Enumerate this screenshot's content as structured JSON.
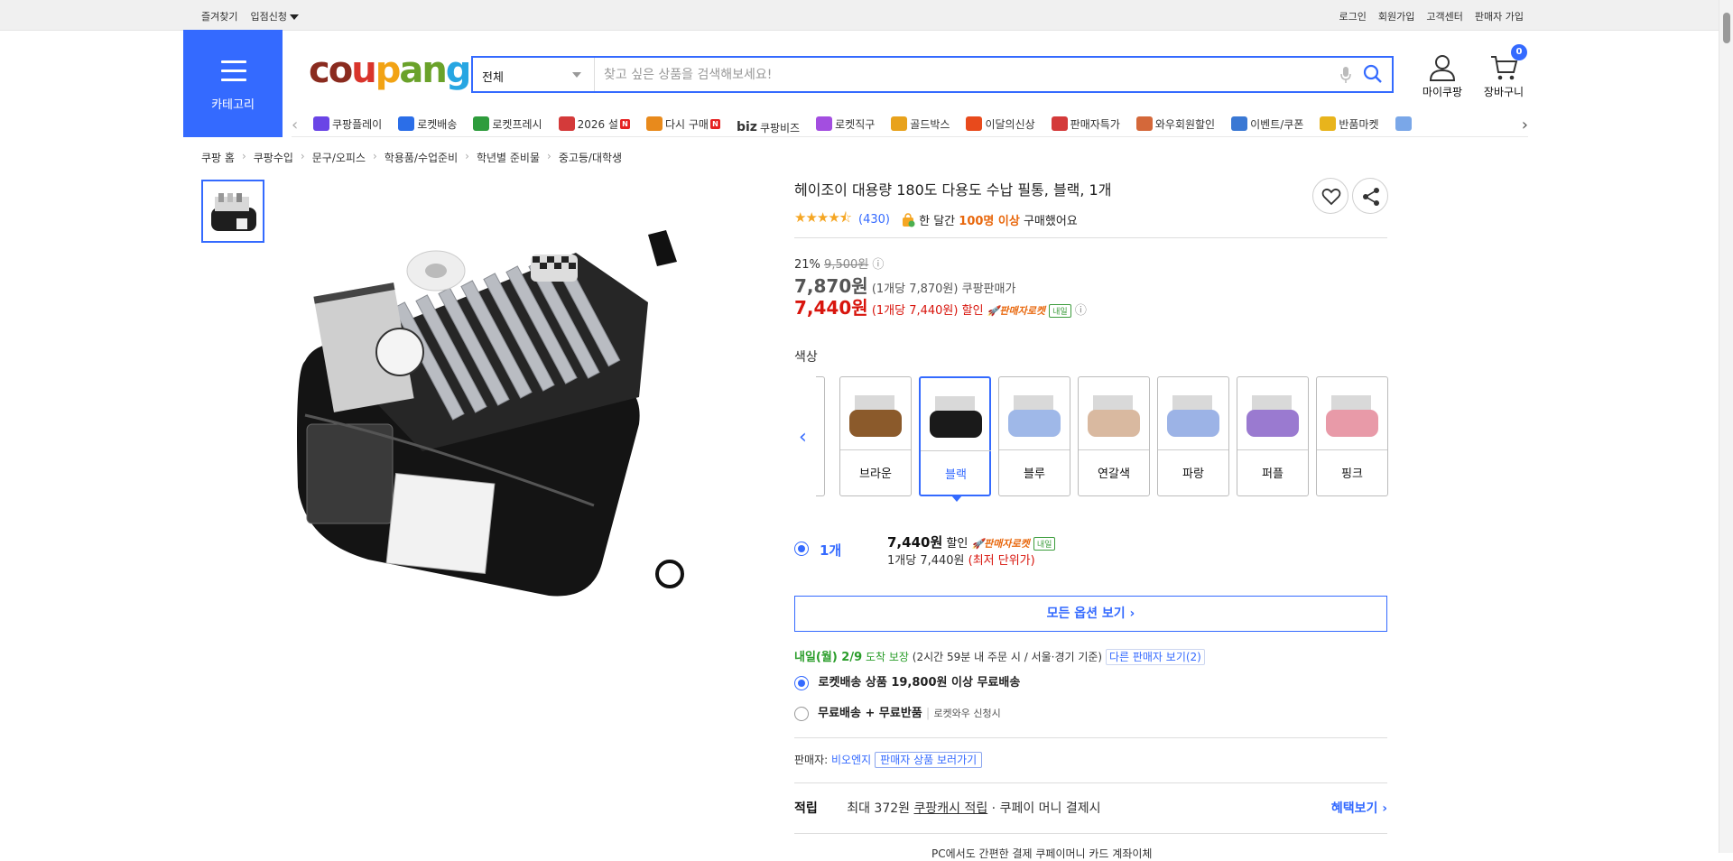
{
  "topbar": {
    "favorites": "즐겨찾기",
    "seller_apply": "입점신청",
    "login": "로그인",
    "signup": "회원가입",
    "customer_center": "고객센터",
    "seller_signup": "판매자 가입"
  },
  "header": {
    "category_label": "카테고리",
    "search_scope": "전체",
    "search_placeholder": "찾고 싶은 상품을 검색해보세요!",
    "my_coupang": "마이쿠팡",
    "cart_label": "장바구니",
    "cart_count": "0"
  },
  "quick_nav": [
    {
      "label": "쿠팡플레이",
      "color": "#6a45e6"
    },
    {
      "label": "로켓배송",
      "color": "#2b6ee8"
    },
    {
      "label": "로켓프레시",
      "color": "#2e9c3c"
    },
    {
      "label": "2026 설",
      "color": "#d43a3a",
      "badge": "N"
    },
    {
      "label": "다시 구매",
      "color": "#e88a1c",
      "badge": "N"
    },
    {
      "label": "쿠팡비즈",
      "prefix": "biz",
      "color": "#333333"
    },
    {
      "label": "로켓직구",
      "color": "#a34ee0"
    },
    {
      "label": "골드박스",
      "color": "#e8a21c"
    },
    {
      "label": "이달의신상",
      "color": "#e84a1c"
    },
    {
      "label": "판매자특가",
      "color": "#d43a3a"
    },
    {
      "label": "와우회원할인",
      "color": "#d4683a"
    },
    {
      "label": "이벤트/쿠폰",
      "color": "#3a78d4"
    },
    {
      "label": "반품마켓",
      "color": "#e8b41c"
    },
    {
      "label": "",
      "color": "#7aa7e8"
    }
  ],
  "breadcrumb": [
    "쿠팡 홈",
    "쿠팡수입",
    "문구/오피스",
    "학용품/수업준비",
    "학년별 준비물",
    "중고등/대학생"
  ],
  "product": {
    "title": "헤이조이 대용량 180도 다용도 수납 필통, 블랙, 1개",
    "rating": 4.5,
    "review_count": "(430)",
    "purchase_prefix": "한 달간 ",
    "purchase_highlight": "100명 이상",
    "purchase_suffix": " 구매했어요",
    "discount_rate": "21%",
    "original_price": "9,500원",
    "sale_price": "7,870원",
    "sale_unit": "(1개당 7,870원)",
    "sale_source": "쿠팡판매가",
    "final_price": "7,440원",
    "final_unit": "(1개당 7,440원)",
    "final_label": "할인",
    "rocket_label": "판매자로켓",
    "tomorrow_badge": "내일"
  },
  "color_option": {
    "label": "색상",
    "swatches": [
      {
        "name": "브라운",
        "color": "#8b5a2b",
        "selected": false
      },
      {
        "name": "블랙",
        "color": "#1a1a1a",
        "selected": true
      },
      {
        "name": "블루",
        "color": "#9fb8e8",
        "selected": false
      },
      {
        "name": "연갈색",
        "color": "#d9b9a0",
        "selected": false
      },
      {
        "name": "파랑",
        "color": "#9cb3e6",
        "selected": false
      },
      {
        "name": "퍼플",
        "color": "#9a7ad0",
        "selected": false
      },
      {
        "name": "핑크",
        "color": "#e89aa8",
        "selected": false
      }
    ]
  },
  "quantity_option": {
    "qty": "1개",
    "price": "7,440원",
    "discount_label": "할인",
    "rocket_label": "판매자로켓",
    "tomorrow_badge": "내일",
    "unit_price": "1개당 7,440원",
    "lowest": "(최저 단위가)"
  },
  "all_options": "모든 옵션 보기 ›",
  "delivery": {
    "date": "내일(월) 2/9",
    "arrive": " 도착 보장",
    "cond": "(2시간 59분 내 주문 시 / 서울·경기 기준)",
    "other_sellers": "다른 판매자 보기(2)",
    "ship1": "로켓배송 상품 19,800원 이상 무료배송",
    "ship2_bold": "무료배송 + 무료반품",
    "ship2_sub": "로켓와우 신청시"
  },
  "seller": {
    "label": "판매자: ",
    "name": "비오엔지",
    "view": "판매자 상품 보러가기"
  },
  "reward": {
    "title": "적립",
    "max": "최대 372원",
    "cash": "쿠팡캐시 적립",
    "rest": " · 쿠페이 머니 결제시",
    "more": "혜택보기 ›"
  },
  "pcpay": "PC에서도 간편한 결제   쿠페이머니   카드   계좌이체"
}
